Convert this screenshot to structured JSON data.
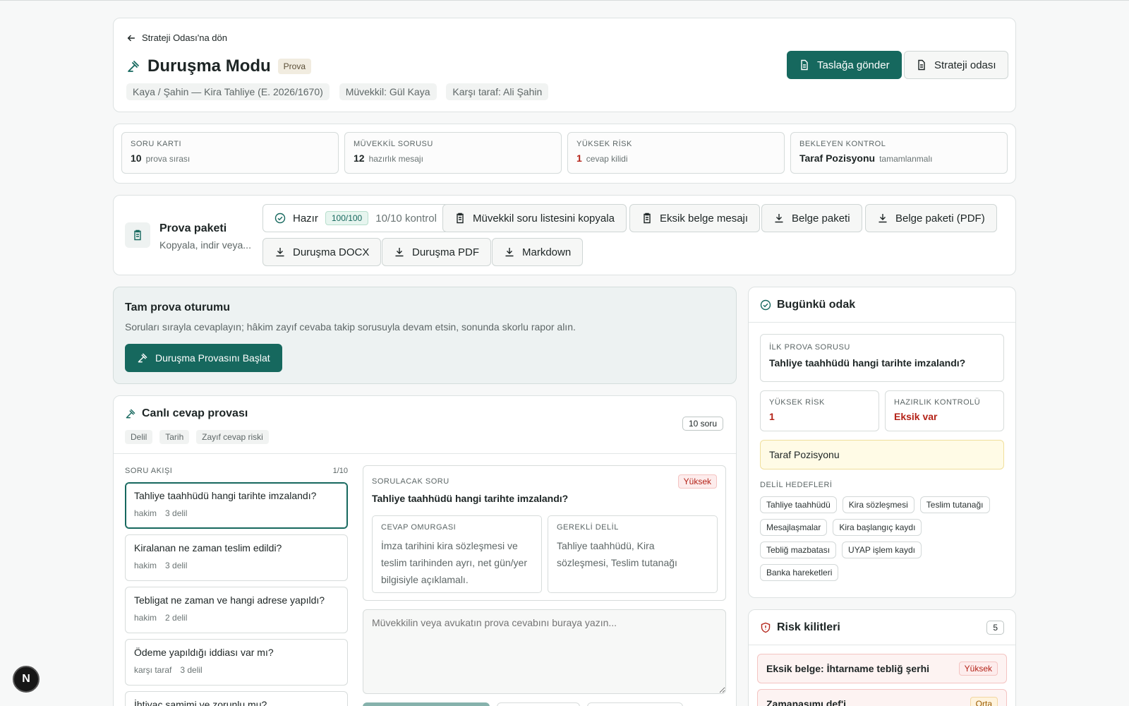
{
  "header": {
    "back_label": "Strateji Odası'na dön",
    "title": "Duruşma Modu",
    "badge": "Prova",
    "chips": [
      "Kaya / Şahin — Kira Tahliye (E. 2026/1670)",
      "Müvekkil: Gül Kaya",
      "Karşı taraf: Ali Şahin"
    ],
    "primary_btn": "Taslağa gönder",
    "secondary_btn": "Strateji odası"
  },
  "stats": [
    {
      "label": "SORU KARTI",
      "value": "10",
      "note": "prova sırası"
    },
    {
      "label": "MÜVEKKİL SORUSU",
      "value": "12",
      "note": "hazırlık mesajı"
    },
    {
      "label": "YÜKSEK RİSK",
      "value": "1",
      "note": "cevap kilidi"
    },
    {
      "label": "BEKLEYEN KONTROL",
      "value": "Taraf Pozisyonu",
      "note": "tamamlanmalı"
    }
  ],
  "package": {
    "title": "Prova paketi",
    "subtitle": "Kopyala, indir veya...",
    "ready_label": "Hazır",
    "score": "100/100",
    "checks": "10/10 kontrol",
    "buttons": [
      "Müvekkil soru listesini kopyala",
      "Eksik belge mesajı",
      "Belge paketi",
      "Belge paketi (PDF)",
      "Duruşma DOCX",
      "Duruşma PDF",
      "Markdown"
    ]
  },
  "session": {
    "title": "Tam prova oturumu",
    "desc": "Soruları sırayla cevaplayın; hâkim zayıf cevaba takip sorusuyla devam etsin, sonunda skorlu rapor alın.",
    "start_btn": "Duruşma Provasını Başlat"
  },
  "live": {
    "title": "Canlı cevap provası",
    "tags": [
      "Delil",
      "Tarih",
      "Zayıf cevap riski"
    ],
    "count": "10 soru",
    "flow_label": "SORU AKIŞI",
    "flow_pos": "1/10",
    "questions": [
      {
        "text": "Tahliye taahhüdü hangi tarihte imzalandı?",
        "who": "hakim",
        "evid": "3 delil"
      },
      {
        "text": "Kiralanan ne zaman teslim edildi?",
        "who": "hakim",
        "evid": "3 delil"
      },
      {
        "text": "Tebligat ne zaman ve hangi adrese yapıldı?",
        "who": "hakim",
        "evid": "2 delil"
      },
      {
        "text": "Ödeme yapıldığı iddiası var mı?",
        "who": "karşı taraf",
        "evid": "3 delil"
      },
      {
        "text": "İhtiyaç samimi ve zorunlu mu?",
        "who": "",
        "evid": ""
      }
    ],
    "ask_label": "SORULACAK SORU",
    "ask_risk": "Yüksek",
    "ask_text": "Tahliye taahhüdü hangi tarihte imzalandı?",
    "backbone_label": "CEVAP OMURGASI",
    "backbone_text": "İmza tarihini kira sözleşmesi ve teslim tarihinden ayrı, net gün/yer bilgisiyle açıklamalı.",
    "evidence_label": "GEREKLİ DELİL",
    "evidence_text": "Tahliye taahhüdü, Kira sözleşmesi, Teslim tutanağı",
    "answer_placeholder": "Müvekkilin veya avukatın prova cevabını buraya yazın..."
  },
  "focus": {
    "title": "Bugünkü odak",
    "first_label": "İLK PROVA SORUSU",
    "first_text": "Tahliye taahhüdü hangi tarihte imzalandı?",
    "risk_label": "YÜKSEK RİSK",
    "risk_value": "1",
    "check_label": "HAZIRLIK KONTROLÜ",
    "check_value": "Eksik var",
    "pending": "Taraf Pozisyonu",
    "targets_label": "DELİL HEDEFLERİ",
    "targets": [
      "Tahliye taahhüdü",
      "Kira sözleşmesi",
      "Teslim tutanağı",
      "Mesajlaşmalar",
      "Kira başlangıç kaydı",
      "Tebliğ mazbatası",
      "UYAP işlem kaydı",
      "Banka hareketleri"
    ]
  },
  "risks": {
    "title": "Risk kilitleri",
    "count": "5",
    "items": [
      {
        "text": "Eksik belge: İhtarname tebliğ şerhi",
        "level": "Yüksek"
      },
      {
        "text": "Zamanaşımı def'i",
        "level": "Orta"
      }
    ]
  },
  "fab_label": "N",
  "colors": {
    "accent": "#16685e",
    "danger": "#b42318"
  }
}
